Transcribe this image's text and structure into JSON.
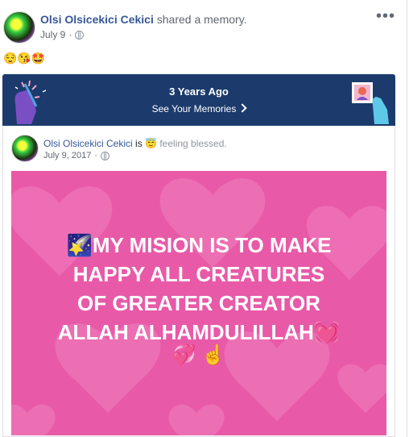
{
  "post": {
    "author": "Olsi Olsicekici Cekici",
    "action": "shared a memory.",
    "date": "July 9",
    "separator": "·",
    "emojis": "😌😘🤩",
    "more": "•••"
  },
  "memory": {
    "title": "3 Years Ago",
    "link": "See Your Memories"
  },
  "shared": {
    "author": "Olsi Olsicekici Cekici",
    "is": "is",
    "feeling_emoji": "😇",
    "feeling": "feeling blessed.",
    "date": "July 9, 2017",
    "separator": "·",
    "image_text_lines": [
      "🌠MY MISION IS TO MAKE",
      "HAPPY ALL CREATURES",
      "OF GREATER CREATOR",
      "ALLAH ALHAMDULILLAH💓"
    ],
    "image_emojis": "💞 ☝️"
  },
  "colors": {
    "link": "#385898",
    "banner": "#1c3b6c",
    "pink": "#e85aa8"
  }
}
